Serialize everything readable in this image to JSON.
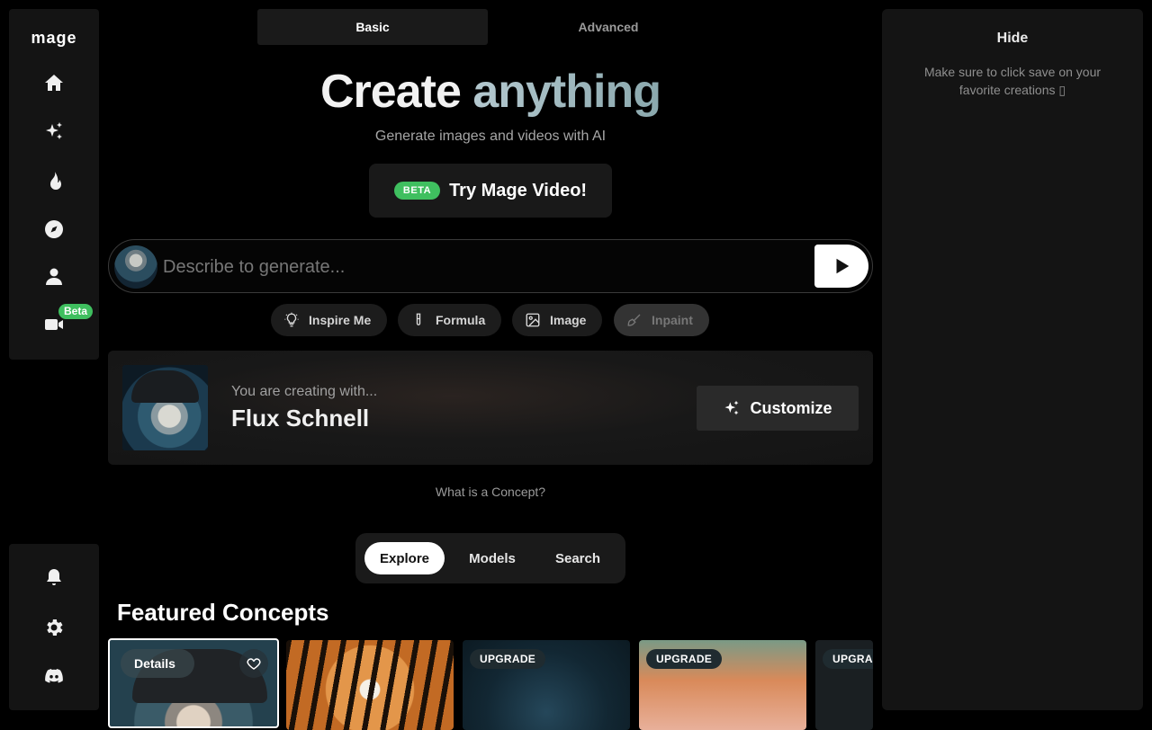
{
  "sidebar": {
    "logo": "mage",
    "nav": [
      {
        "icon": "home-icon"
      },
      {
        "icon": "sparkles-icon"
      },
      {
        "icon": "flame-icon"
      },
      {
        "icon": "compass-icon"
      },
      {
        "icon": "user-icon"
      },
      {
        "icon": "video-icon",
        "badge": "Beta"
      }
    ],
    "bottom": [
      {
        "icon": "bell-icon"
      },
      {
        "icon": "gear-icon"
      },
      {
        "icon": "discord-icon"
      }
    ]
  },
  "mode_tabs": {
    "basic": "Basic",
    "advanced": "Advanced",
    "active": "Basic"
  },
  "hero": {
    "title_word1": "Create",
    "title_word2": "anything",
    "subtitle": "Generate images and videos with AI"
  },
  "video_promo": {
    "badge": "BETA",
    "label": "Try Mage Video!"
  },
  "prompt": {
    "placeholder": "Describe to generate...",
    "value": ""
  },
  "tools": [
    {
      "label": "Inspire Me",
      "icon": "lightbulb-icon",
      "disabled": false
    },
    {
      "label": "Formula",
      "icon": "test-tube-icon",
      "disabled": false
    },
    {
      "label": "Image",
      "icon": "image-icon",
      "disabled": false
    },
    {
      "label": "Inpaint",
      "icon": "brush-icon",
      "disabled": true
    }
  ],
  "concept": {
    "subtitle": "You are creating with...",
    "name": "Flux Schnell",
    "customize_label": "Customize",
    "help_link": "What is a Concept?"
  },
  "explore_tabs": {
    "items": [
      "Explore",
      "Models",
      "Search"
    ],
    "active": "Explore"
  },
  "featured": {
    "title": "Featured Concepts",
    "tiles": [
      {
        "details_label": "Details",
        "selected": true
      },
      {
        "badge": ""
      },
      {
        "badge": "UPGRADE"
      },
      {
        "badge": "UPGRADE"
      },
      {
        "badge": "UPGRADE"
      }
    ]
  },
  "right_panel": {
    "hide_label": "Hide",
    "note": "Make sure to click save on your favorite creations ▯"
  },
  "colors": {
    "accent_green": "#3fbf5f",
    "panel_bg": "#141414",
    "page_bg": "#000000"
  }
}
